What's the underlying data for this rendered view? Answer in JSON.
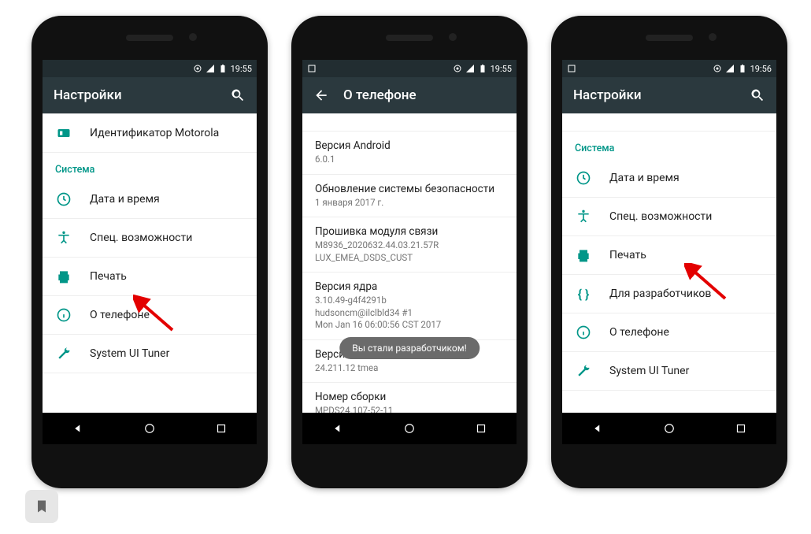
{
  "phone1": {
    "time": "19:55",
    "title": "Настройки",
    "motorola_label": "Идентификатор Motorola",
    "section": "Система",
    "items": [
      {
        "label": "Дата и время"
      },
      {
        "label": "Спец. возможности"
      },
      {
        "label": "Печать"
      },
      {
        "label": "О телефоне"
      },
      {
        "label": "System UI Tuner"
      }
    ]
  },
  "phone2": {
    "time": "19:55",
    "title": "О телефоне",
    "rows": [
      {
        "title": "Версия Android",
        "sub": "6.0.1"
      },
      {
        "title": "Обновление системы безопасности",
        "sub": "1 января 2017 г."
      },
      {
        "title": "Прошивка модуля связи",
        "sub": "M8936_2020632.44.03.21.57R\nLUX_EMEA_DSDS_CUST"
      },
      {
        "title": "Версия ядра",
        "sub": "3.10.49-g4f4291b\nhudsoncm@ilclbld34 #1\nMon Jan 16 06:00:56 CST 2017"
      },
      {
        "title": "Версия системы",
        "sub": "24.211.12    tmea"
      },
      {
        "title": "Номер сборки",
        "sub": "MPDS24.107-52-11"
      }
    ],
    "toast": "Вы стали разработчиком!"
  },
  "phone3": {
    "time": "19:56",
    "title": "Настройки",
    "section": "Система",
    "items": [
      {
        "label": "Дата и время"
      },
      {
        "label": "Спец. возможности"
      },
      {
        "label": "Печать"
      },
      {
        "label": "Для разработчиков"
      },
      {
        "label": "О телефоне"
      },
      {
        "label": "System UI Tuner"
      }
    ]
  }
}
